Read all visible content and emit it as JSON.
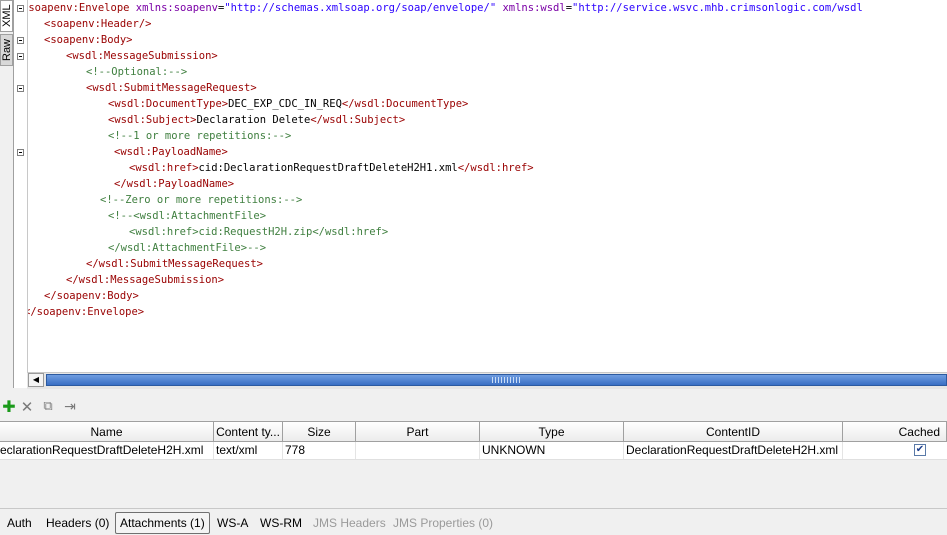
{
  "side_tabs": [
    "XML",
    "Raw"
  ],
  "xml_lines": [
    [
      [
        "t",
        "<soapenv:Envelope "
      ],
      [
        "a",
        "xmlns:soapenv"
      ],
      [
        "x",
        "="
      ],
      [
        "v",
        "\"http://schemas.xmlsoap.org/soap/envelope/\""
      ],
      [
        "x",
        " "
      ],
      [
        "a",
        "xmlns:wsdl"
      ],
      [
        "x",
        "="
      ],
      [
        "v",
        "\"http://service.wsvc.mhb.crimsonlogic.com/wsdl"
      ]
    ],
    [
      [
        "t",
        "<soapenv:Header/>"
      ]
    ],
    [
      [
        "t",
        "<soapenv:Body>"
      ]
    ],
    [
      [
        "t",
        "<wsdl:MessageSubmission>"
      ]
    ],
    [
      [
        "c",
        "<!--Optional:-->"
      ]
    ],
    [
      [
        "t",
        "<wsdl:SubmitMessageRequest>"
      ]
    ],
    [
      [
        "t",
        "<wsdl:DocumentType>"
      ],
      [
        "x",
        "DEC_EXP_CDC_IN_REQ"
      ],
      [
        "t",
        "</wsdl:DocumentType>"
      ]
    ],
    [
      [
        "t",
        "<wsdl:Subject>"
      ],
      [
        "x",
        "Declaration Delete"
      ],
      [
        "t",
        "</wsdl:Subject>"
      ]
    ],
    [
      [
        "c",
        "<!--1 or more repetitions:-->"
      ]
    ],
    [
      [
        "t",
        "<wsdl:PayloadName>"
      ]
    ],
    [
      [
        "t",
        "<wsdl:href>"
      ],
      [
        "x",
        "cid:DeclarationRequestDraftDeleteH2H1.xml"
      ],
      [
        "t",
        "</wsdl:href>"
      ]
    ],
    [
      [
        "t",
        "</wsdl:PayloadName>"
      ]
    ],
    [
      [
        "c",
        "<!--Zero or more repetitions:-->"
      ]
    ],
    [
      [
        "c",
        "<!--<wsdl:AttachmentFile>"
      ]
    ],
    [
      [
        "c",
        "<wsdl:href>cid:RequestH2H.zip</wsdl:href>"
      ]
    ],
    [
      [
        "c",
        "</wsdl:AttachmentFile>-->"
      ]
    ],
    [
      [
        "t",
        "</wsdl:SubmitMessageRequest>"
      ]
    ],
    [
      [
        "t",
        "</wsdl:MessageSubmission>"
      ]
    ],
    [
      [
        "t",
        "</soapenv:Body>"
      ]
    ],
    [
      [
        "t",
        "</soapenv:Envelope>"
      ]
    ]
  ],
  "toolbar": {
    "add_glyph": "✚",
    "delete_glyph": "✕",
    "reload_glyph": "⧉",
    "export_glyph": "⇥"
  },
  "attachments_table": {
    "columns": [
      "Name",
      "Content ty...",
      "Size",
      "Part",
      "Type",
      "ContentID",
      "Cached"
    ],
    "rows": [
      {
        "name": "eclarationRequestDraftDeleteH2H.xml",
        "content_type": "text/xml",
        "size": "778",
        "part": "",
        "type": "UNKNOWN",
        "content_id": "DeclarationRequestDraftDeleteH2H.xml",
        "cached": "✔"
      }
    ]
  },
  "bottom_tabs": {
    "auth": "Auth",
    "headers": "Headers (0)",
    "attachments": "Attachments (1)",
    "wsa": "WS-A",
    "wsrm": "WS-RM",
    "jms_headers": "JMS Headers",
    "jms_properties": "JMS Properties (0)"
  }
}
